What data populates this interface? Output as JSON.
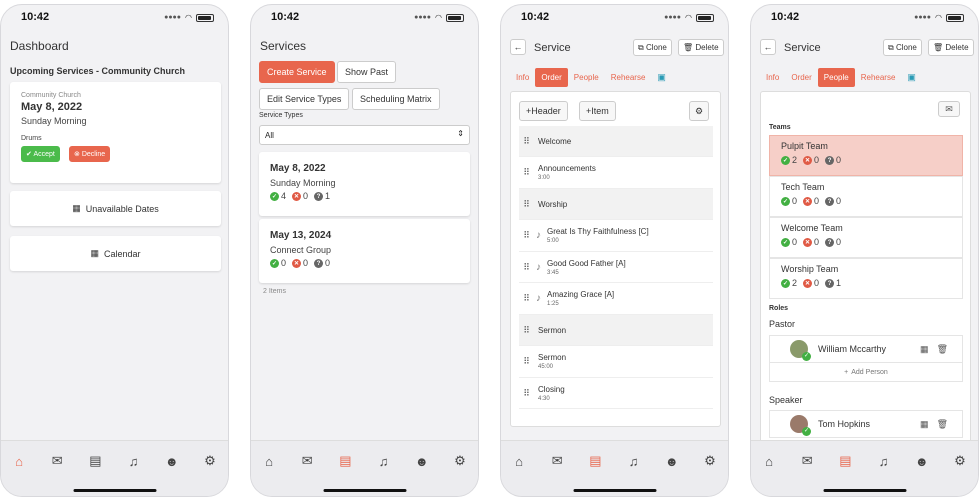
{
  "status": {
    "time": "10:42"
  },
  "colors": {
    "accent": "#e8664d",
    "green": "#43b043",
    "red": "#e05a45",
    "teal": "#2a9bb5"
  },
  "tabbar_icons": [
    "home-icon",
    "chat-icon",
    "clipboard-icon",
    "music-icon",
    "people-icon",
    "gear-icon"
  ],
  "dashboard": {
    "title": "Dashboard",
    "subtitle": "Upcoming Services - Community Church",
    "card": {
      "org": "Community Church",
      "date": "May 8, 2022",
      "service": "Sunday Morning",
      "role": "Drums",
      "accept": "Accept",
      "decline": "Decline"
    },
    "unavailable": "Unavailable Dates",
    "calendar": "Calendar"
  },
  "services": {
    "title": "Services",
    "buttons": {
      "create": "Create Service",
      "show_past": "Show Past",
      "edit_types": "Edit Service Types",
      "matrix": "Scheduling Matrix"
    },
    "types_label": "Service Types",
    "types_value": "All",
    "items": [
      {
        "date": "May 8, 2022",
        "name": "Sunday Morning",
        "accepted": "4",
        "declined": "0",
        "pending": "1"
      },
      {
        "date": "May 13, 2024",
        "name": "Connect Group",
        "accepted": "0",
        "declined": "0",
        "pending": "0"
      }
    ],
    "count": "2 Items"
  },
  "service_order": {
    "title": "Service",
    "clone": "Clone",
    "delete": "Delete",
    "tabs": [
      "Info",
      "Order",
      "People",
      "Rehearse"
    ],
    "add_header": "Header",
    "add_item": "Item",
    "rows": [
      {
        "type": "header",
        "title": "Welcome"
      },
      {
        "type": "item",
        "title": "Announcements",
        "sub": "3:00"
      },
      {
        "type": "header",
        "title": "Worship"
      },
      {
        "type": "song",
        "title": "Great Is Thy Faithfulness [C]",
        "sub": "5:00"
      },
      {
        "type": "song",
        "title": "Good Good Father [A]",
        "sub": "3:45"
      },
      {
        "type": "song",
        "title": "Amazing Grace [A]",
        "sub": "1:25"
      },
      {
        "type": "header",
        "title": "Sermon"
      },
      {
        "type": "item",
        "title": "Sermon",
        "sub": "45:00"
      },
      {
        "type": "item",
        "title": "Closing",
        "sub": "4:30"
      }
    ]
  },
  "service_people": {
    "title": "Service",
    "clone": "Clone",
    "delete": "Delete",
    "tabs": [
      "Info",
      "Order",
      "People",
      "Rehearse"
    ],
    "teams_label": "Teams",
    "teams": [
      {
        "name": "Pulpit Team",
        "accepted": "2",
        "declined": "0",
        "pending": "0"
      },
      {
        "name": "Tech Team",
        "accepted": "0",
        "declined": "0",
        "pending": "0"
      },
      {
        "name": "Welcome Team",
        "accepted": "0",
        "declined": "0",
        "pending": "0"
      },
      {
        "name": "Worship Team",
        "accepted": "2",
        "declined": "0",
        "pending": "1"
      }
    ],
    "roles_label": "Roles",
    "roles": [
      {
        "role": "Pastor",
        "person": "William Mccarthy"
      },
      {
        "role": "Speaker",
        "person": "Tom Hopkins"
      }
    ],
    "add_person": "Add Person"
  }
}
